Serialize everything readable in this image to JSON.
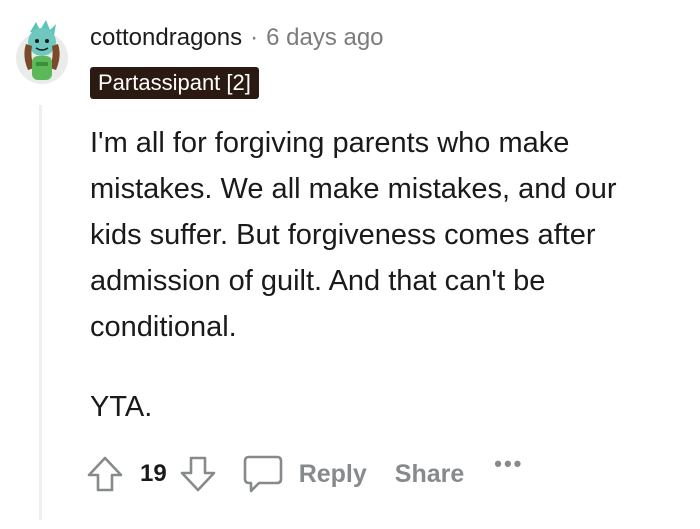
{
  "comment": {
    "username": "cottondragons",
    "separator": "·",
    "timestamp": "6 days ago",
    "flair": "Partassipant [2]",
    "paragraphs": [
      "I'm all for forgiving parents who make mistakes. We all make mistakes, and our kids suffer. But forgiveness comes after admission of guilt. And that can't be conditional.",
      "YTA."
    ]
  },
  "actions": {
    "upvote_icon": "upvote-arrow-icon",
    "vote_count": "19",
    "downvote_icon": "downvote-arrow-icon",
    "comment_icon": "speech-bubble-icon",
    "reply_label": "Reply",
    "share_label": "Share",
    "more_label": "•••"
  },
  "colors": {
    "flair_bg": "#2a1a12",
    "muted": "#7c7c7c",
    "action_gray": "#878a8c",
    "thread_line": "#edeff1"
  }
}
